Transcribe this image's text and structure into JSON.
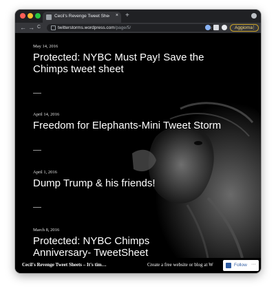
{
  "browser": {
    "tab_title": "Cecil's Revenge Tweet Shee…",
    "tab_close": "×",
    "new_tab": "+",
    "back": "←",
    "forward": "→",
    "reload": "C",
    "url_host": "twitterstorms.wordpress.com",
    "url_path": "/page/5/",
    "bookmark": "☆",
    "update_label": "Aggiorna",
    "update_more": "⋮"
  },
  "posts": [
    {
      "date": "May 14, 2016",
      "title": "Protected: NYBC Must Pay! Save the Chimps tweet sheet"
    },
    {
      "date": "April 14, 2016",
      "title": "Freedom for Elephants-Mini Tweet Storm"
    },
    {
      "date": "April 1, 2016",
      "title": "Dump Trump & his friends!"
    },
    {
      "date": "March 8, 2016",
      "title": "Protected: NYBC Chimps Anniversary- TweetSheet"
    }
  ],
  "footer": {
    "site_name": "Cecil's Revenge Tweet Sheets – It's tim…",
    "cta": "Create a free website or blog at W",
    "follow_label": "Follow",
    "follow_more": "···"
  },
  "colors": {
    "background": "#000000",
    "text": "#ffffff",
    "update_accent": "#c9a227"
  },
  "icons": {
    "background_image": "lion-photo",
    "bookmark": "star-icon",
    "extensions": [
      "extension-icon",
      "puzzle-icon",
      "profile-icon"
    ],
    "follow": "follow-icon"
  }
}
